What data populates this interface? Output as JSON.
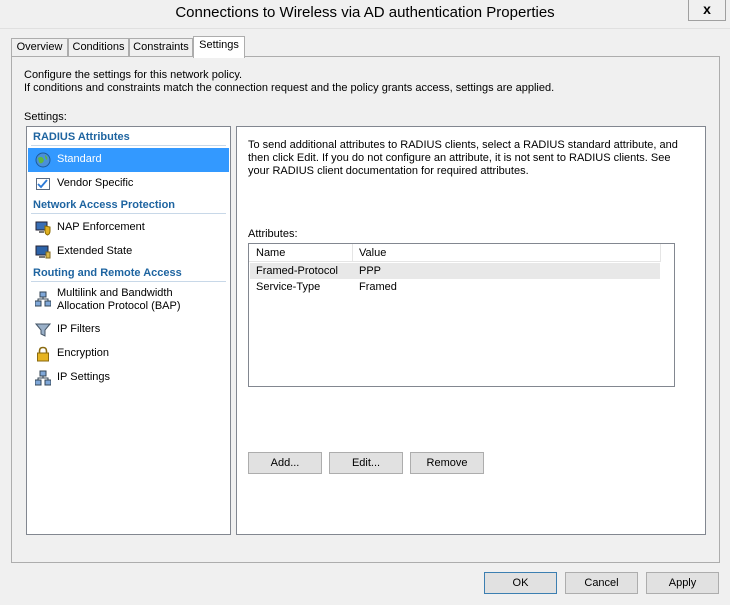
{
  "window": {
    "title": "Connections to Wireless via AD authentication Properties",
    "close_label": "x"
  },
  "tabs": [
    {
      "label": "Overview"
    },
    {
      "label": "Conditions"
    },
    {
      "label": "Constraints"
    },
    {
      "label": "Settings"
    }
  ],
  "page": {
    "description_line1": "Configure the settings for this network policy.",
    "description_line2": "If conditions and constraints match the connection request and the policy grants access, settings are applied.",
    "settings_label": "Settings:"
  },
  "nav": {
    "groups": [
      {
        "header": "RADIUS Attributes"
      },
      {
        "header": "Network Access Protection"
      },
      {
        "header": "Routing and Remote Access"
      }
    ],
    "items": [
      {
        "label": "Standard",
        "icon": "globe-icon"
      },
      {
        "label": "Vendor Specific",
        "icon": "checklist-icon"
      },
      {
        "label": "NAP Enforcement",
        "icon": "computer-shield-icon"
      },
      {
        "label": "Extended State",
        "icon": "computer-icon"
      },
      {
        "label": "Multilink and Bandwidth",
        "label2": "Allocation Protocol (BAP)",
        "icon": "network-icon"
      },
      {
        "label": "IP Filters",
        "icon": "filter-icon"
      },
      {
        "label": "Encryption",
        "icon": "lock-icon"
      },
      {
        "label": "IP Settings",
        "icon": "network-icon"
      }
    ]
  },
  "right": {
    "description": "To send additional attributes to RADIUS clients, select a RADIUS standard attribute, and then click Edit. If you do not configure an attribute, it is not sent to RADIUS clients. See your RADIUS client documentation for required attributes.",
    "attributes_label": "Attributes:",
    "columns": [
      "Name",
      "Value"
    ],
    "rows": [
      {
        "name": "Framed-Protocol",
        "value": "PPP"
      },
      {
        "name": "Service-Type",
        "value": "Framed"
      }
    ],
    "add_label": "Add...",
    "edit_label": "Edit...",
    "remove_label": "Remove"
  },
  "footer": {
    "ok_label": "OK",
    "cancel_label": "Cancel",
    "apply_label": "Apply"
  },
  "colors": {
    "selection": "#3399ff",
    "group_header": "#1e64a0"
  }
}
